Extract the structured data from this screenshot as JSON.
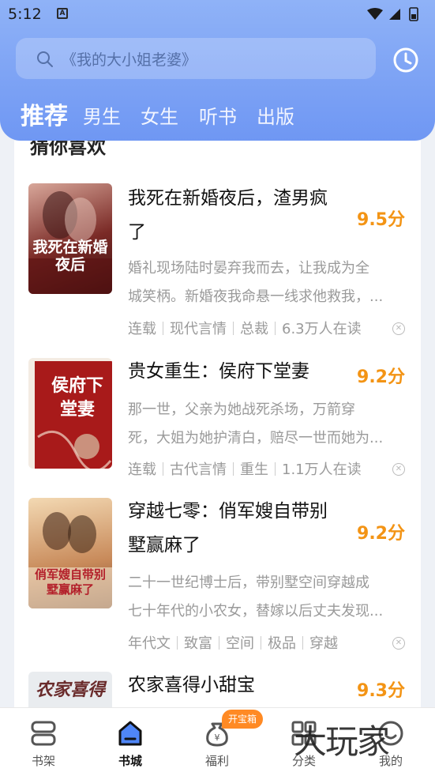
{
  "status": {
    "time": "5:12",
    "badge": "A"
  },
  "search": {
    "placeholder": "《我的大小姐老婆》"
  },
  "tabs": [
    {
      "label": "推荐",
      "active": true
    },
    {
      "label": "男生"
    },
    {
      "label": "女生"
    },
    {
      "label": "听书"
    },
    {
      "label": "出版"
    }
  ],
  "section": {
    "title": "猜你喜欢"
  },
  "books": [
    {
      "title_lines": [
        "我死在新婚夜后，渣男疯",
        "了"
      ],
      "score": "9.5分",
      "desc_lines": [
        "婚礼现场陆时晏弃我而去，让我成为全",
        "城笑柄。新婚夜我命悬一线求他救我，..."
      ],
      "tags": [
        "连载",
        "现代言情",
        "总裁",
        "6.3万人在读"
      ],
      "cover_text": "我死在新婚夜后",
      "cover_colors": [
        "#7a2a26",
        "#d8a79a"
      ]
    },
    {
      "title_lines": [
        "贵女重生：侯府下堂妻"
      ],
      "score": "9.2分",
      "desc_lines": [
        "那一世，父亲为她战死杀场，万箭穿",
        "死，大姐为她护清白，赔尽一世而她为..."
      ],
      "tags": [
        "连载",
        "古代言情",
        "重生",
        "1.1万人在读"
      ],
      "cover_text": "侯府下堂妻",
      "cover_colors": [
        "#a81a1a",
        "#f4ece3"
      ]
    },
    {
      "title_lines": [
        "穿越七零：俏军嫂自带别",
        "墅赢麻了"
      ],
      "score": "9.2分",
      "desc_lines": [
        "二十一世纪博士后，带别墅空间穿越成",
        "七十年代的小农女，替嫁以后丈夫发现..."
      ],
      "tags": [
        "年代文",
        "致富",
        "空间",
        "极品",
        "穿越"
      ],
      "cover_text": "俏军嫂自带别墅赢麻了",
      "cover_colors": [
        "#c88a5a",
        "#f3d9b3"
      ]
    },
    {
      "title_lines": [
        "农家喜得小甜宝"
      ],
      "score": "9.3分",
      "desc_lines": [],
      "tags": [],
      "cover_text": "农家喜得",
      "cover_colors": [
        "#e9ecef",
        "#6a2b2b"
      ]
    }
  ],
  "nav": [
    {
      "label": "书架",
      "icon": "bookshelf-icon"
    },
    {
      "label": "书城",
      "icon": "bookstore-icon",
      "active": true
    },
    {
      "label": "福利",
      "icon": "welfare-icon"
    },
    {
      "label": "分类",
      "icon": "category-icon"
    },
    {
      "label": "我的",
      "icon": "profile-icon"
    }
  ],
  "treasure_badge": "开宝箱",
  "watermark": "大玩家",
  "colors": {
    "header_top": "#8fb2f7",
    "header_bottom": "#6f97f3",
    "score": "#f39415",
    "badge": "#ff8a24"
  }
}
